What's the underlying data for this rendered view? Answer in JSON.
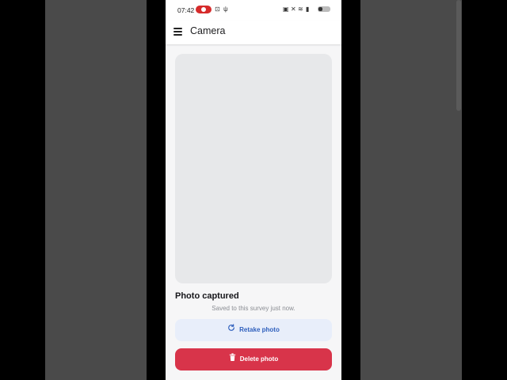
{
  "status_bar": {
    "time": "07:42",
    "icons": [
      "record-icon",
      "cast-icon",
      "usb-icon",
      "notification-icon",
      "mute-icon",
      "wifi-icon",
      "signal-icon",
      "battery-icon"
    ]
  },
  "app_bar": {
    "title": "Camera",
    "menu_icon": "hamburger-menu-icon"
  },
  "photo": {
    "status_title": "Photo captured",
    "status_subtitle": "Saved to this survey just now."
  },
  "actions": {
    "retake_label": "Retake photo",
    "retake_icon": "refresh-icon",
    "delete_label": "Delete photo",
    "delete_icon": "trash-icon"
  },
  "colors": {
    "accent_blue": "#2e5fbd",
    "retake_bg": "#e8eefa",
    "danger": "#d8344a",
    "record_red": "#d62b2b"
  }
}
